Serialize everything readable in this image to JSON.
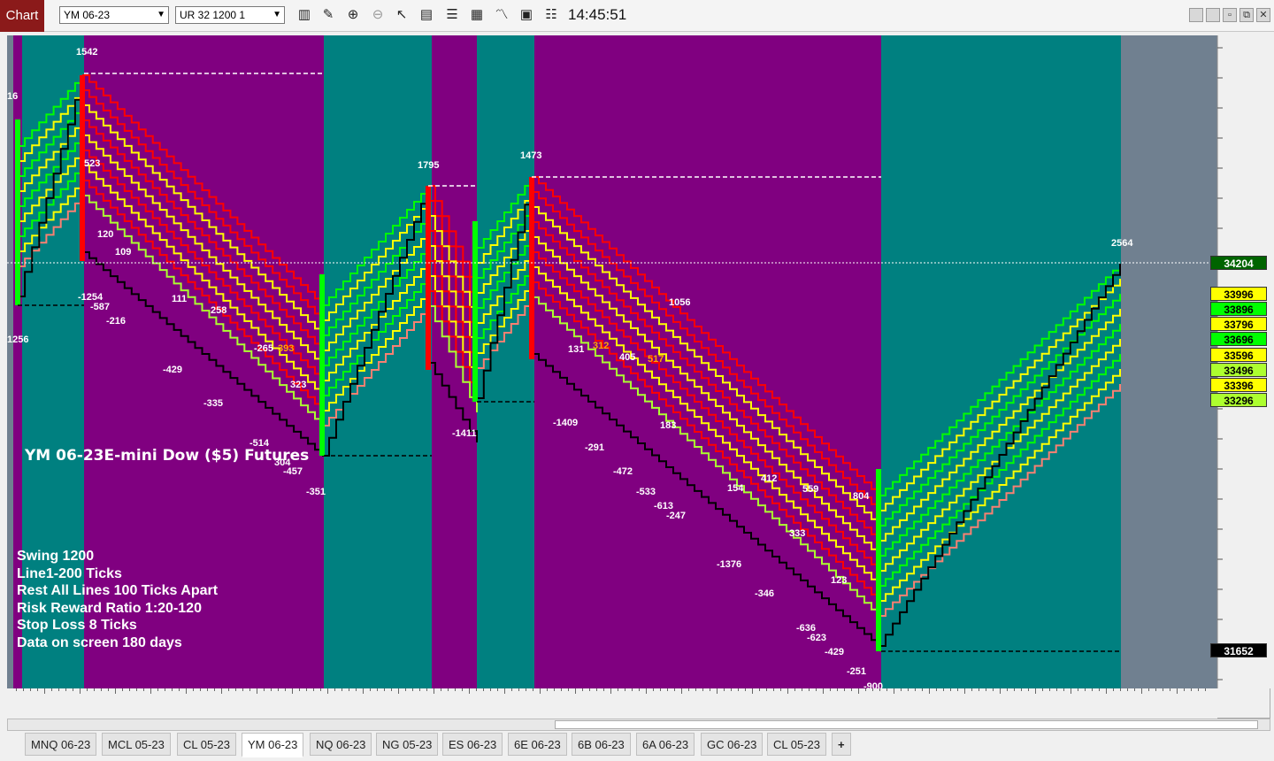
{
  "toolbar": {
    "chart_label": "Chart",
    "instrument": "YM 06-23",
    "bar_type": "UR 32 1200 1",
    "time": "14:45:51",
    "icons": [
      "bars-icon",
      "draw-icon",
      "zoom-in-icon",
      "zoom-out-icon",
      "pointer-icon",
      "data-box-icon",
      "properties-icon",
      "indicators-icon",
      "strategies-icon",
      "templates-icon",
      "list-icon"
    ]
  },
  "chart": {
    "title": "YM 06-23E-mini Dow ($5) Futures",
    "info_lines": [
      "Swing  1200",
      "Line1-200 Ticks",
      "Rest All Lines  100 Ticks Apart",
      "Risk Reward Ratio  1:20-120",
      "Stop Loss 8 Ticks",
      "Data on screen 180 days"
    ],
    "colors": {
      "teal": "#008080",
      "purple": "#800080",
      "grey": "#708090",
      "red": "#ff0000",
      "yellow": "#ffff00",
      "green": "#00ff00",
      "lightgreen": "#adff2f",
      "salmon": "#fa8072"
    },
    "swing_labels": [
      {
        "text": "1542"
      },
      {
        "text": "16"
      },
      {
        "text": "1256"
      },
      {
        "text": "523"
      },
      {
        "text": "120"
      },
      {
        "text": "109"
      },
      {
        "text": "-1254"
      },
      {
        "text": "-587"
      },
      {
        "text": "-216"
      },
      {
        "text": "111"
      },
      {
        "text": "258"
      },
      {
        "text": "-429"
      },
      {
        "text": "-265"
      },
      {
        "text": "393"
      },
      {
        "text": "-335"
      },
      {
        "text": "323"
      },
      {
        "text": "-514"
      },
      {
        "text": "304"
      },
      {
        "text": "-457"
      },
      {
        "text": "-351"
      },
      {
        "text": "1795"
      },
      {
        "text": "-1411"
      },
      {
        "text": "1473"
      },
      {
        "text": "-1409"
      },
      {
        "text": "131"
      },
      {
        "text": "312"
      },
      {
        "text": "405"
      },
      {
        "text": "517"
      },
      {
        "text": "-291"
      },
      {
        "text": "-472"
      },
      {
        "text": "183"
      },
      {
        "text": "-533"
      },
      {
        "text": "-613"
      },
      {
        "text": "-247"
      },
      {
        "text": "1056"
      },
      {
        "text": "154"
      },
      {
        "text": "412"
      },
      {
        "text": "559"
      },
      {
        "text": "804"
      },
      {
        "text": "-1376"
      },
      {
        "text": "333"
      },
      {
        "text": "-346"
      },
      {
        "text": "123"
      },
      {
        "text": "-636"
      },
      {
        "text": "-623"
      },
      {
        "text": "-429"
      },
      {
        "text": "-251"
      },
      {
        "text": "-900"
      },
      {
        "text": "2564"
      }
    ],
    "price_labels": [
      {
        "text": "34204",
        "bg": "#006400",
        "fg": "#ffffff"
      },
      {
        "text": "33996",
        "bg": "#ffff00",
        "fg": "#000000"
      },
      {
        "text": "33896",
        "bg": "#00ff00",
        "fg": "#000000"
      },
      {
        "text": "33796",
        "bg": "#ffff00",
        "fg": "#000000"
      },
      {
        "text": "33696",
        "bg": "#00ff00",
        "fg": "#000000"
      },
      {
        "text": "33596",
        "bg": "#ffff00",
        "fg": "#000000"
      },
      {
        "text": "33496",
        "bg": "#adff2f",
        "fg": "#000000"
      },
      {
        "text": "33396",
        "bg": "#ffff00",
        "fg": "#000000"
      },
      {
        "text": "33296",
        "bg": "#adff2f",
        "fg": "#000000"
      },
      {
        "text": "31652",
        "bg": "#000000",
        "fg": "#ffffff"
      }
    ]
  },
  "tabs": [
    {
      "label": "MNQ 06-23"
    },
    {
      "label": "MCL 05-23"
    },
    {
      "label": "CL 05-23"
    },
    {
      "label": "YM 06-23",
      "active": true
    },
    {
      "label": "NQ 06-23"
    },
    {
      "label": "NG 05-23"
    },
    {
      "label": "ES 06-23"
    },
    {
      "label": "6E 06-23"
    },
    {
      "label": "6B 06-23"
    },
    {
      "label": "6A 06-23"
    },
    {
      "label": "GC 06-23"
    },
    {
      "label": "CL 05-23"
    }
  ],
  "add_tab_label": "+"
}
